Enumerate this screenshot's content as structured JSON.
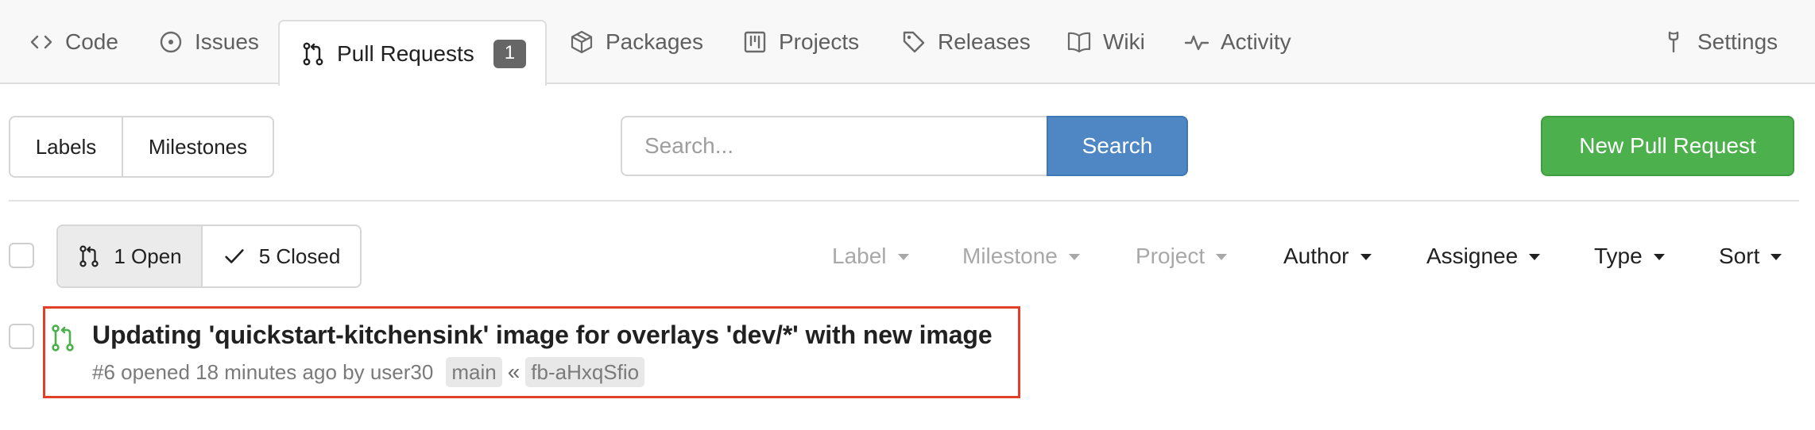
{
  "tabs": [
    {
      "label": "Code",
      "icon": "code-icon"
    },
    {
      "label": "Issues",
      "icon": "issue-icon"
    },
    {
      "label": "Pull Requests",
      "icon": "pull-request-icon",
      "active": true,
      "count": "1"
    },
    {
      "label": "Packages",
      "icon": "package-icon"
    },
    {
      "label": "Projects",
      "icon": "project-icon"
    },
    {
      "label": "Releases",
      "icon": "tag-icon"
    },
    {
      "label": "Wiki",
      "icon": "book-icon"
    },
    {
      "label": "Activity",
      "icon": "pulse-icon"
    },
    {
      "label": "Settings",
      "icon": "tool-icon"
    }
  ],
  "toolbar": {
    "labels_label": "Labels",
    "milestones_label": "Milestones",
    "search_placeholder": "Search...",
    "search_value": "",
    "search_button": "Search",
    "new_pr_button": "New Pull Request"
  },
  "state_filter": {
    "open_label": "1 Open",
    "closed_label": "5 Closed",
    "selected": "open"
  },
  "filters": [
    {
      "label": "Label",
      "enabled": false
    },
    {
      "label": "Milestone",
      "enabled": false
    },
    {
      "label": "Project",
      "enabled": false
    },
    {
      "label": "Author",
      "enabled": true
    },
    {
      "label": "Assignee",
      "enabled": true
    },
    {
      "label": "Type",
      "enabled": true
    },
    {
      "label": "Sort",
      "enabled": true
    }
  ],
  "pull_requests": [
    {
      "title": "Updating 'quickstart-kitchensink' image for overlays 'dev/*' with new image",
      "meta": "#6 opened 18 minutes ago by user30",
      "base_branch": "main",
      "arrow": "«",
      "head_branch": "fb-aHxqSfio",
      "icon": "open-pull-request-icon",
      "status_color": "#4cb04d"
    }
  ],
  "colors": {
    "primary": "#4f87c5",
    "success": "#4cb04d",
    "highlight": "#e0402a",
    "badge": "#666666"
  }
}
